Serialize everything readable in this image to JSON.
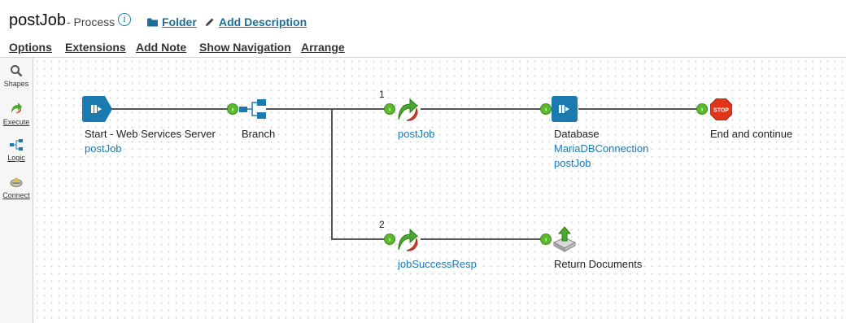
{
  "header": {
    "title": "postJob",
    "subtitle": "- Process",
    "folder_label": "Folder",
    "add_description_label": "Add Description"
  },
  "menu": {
    "options": "Options",
    "extensions": "Extensions",
    "add_note": "Add Note",
    "show_navigation": "Show Navigation",
    "arrange": "Arrange"
  },
  "sidebar": {
    "items": [
      {
        "label": "Shapes",
        "icon": "search-icon"
      },
      {
        "label": "Execute",
        "icon": "execute-icon"
      },
      {
        "label": "Logic",
        "icon": "logic-icon"
      },
      {
        "label": "Connect",
        "icon": "connect-icon"
      }
    ]
  },
  "process": {
    "start": {
      "label": "Start - Web Services Server",
      "sub": "postJob"
    },
    "branch": {
      "label": "Branch"
    },
    "branch_numbers": [
      "1",
      "2"
    ],
    "map1": {
      "label": "postJob"
    },
    "database": {
      "label": "Database",
      "sub1": "MariaDBConnection",
      "sub2": "postJob"
    },
    "stop": {
      "label": "End and continue",
      "icon_text": "STOP"
    },
    "map2": {
      "label": "jobSuccessResp"
    },
    "return": {
      "label": "Return Documents"
    }
  },
  "colors": {
    "accent": "#1b6f98",
    "connector_blue": "#1b7ab0",
    "connector_green": "#5cb82e",
    "stop_red": "#e0341b"
  }
}
